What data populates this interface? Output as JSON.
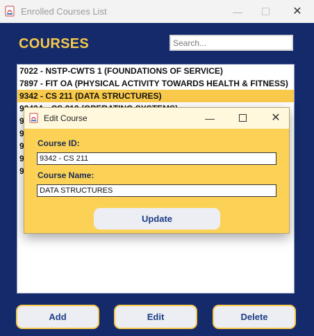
{
  "window": {
    "title": "Enrolled Courses List",
    "min": "—",
    "close": "✕"
  },
  "heading": "COURSES",
  "search": {
    "placeholder": "Search..."
  },
  "courses": [
    "7022 - NSTP-CWTS 1 (FOUNDATIONS OF SERVICE)",
    "7897 - FIT OA (PHYSICAL ACTIVITY TOWARDS HEALTH & FITNESS)",
    "9342 - CS 211 (DATA STRUCTURES)",
    "9343A - CS 212 (OPERATING SYSTEMS)",
    "9",
    "9",
    "9",
    "9",
    "9"
  ],
  "selected_course": "9342 - CS 211 (DATA STRUCTURES)",
  "buttons": {
    "add": "Add",
    "edit": "Edit",
    "delete": "Delete"
  },
  "dialog": {
    "title": "Edit Course",
    "min": "—",
    "close": "✕",
    "id_label": "Course ID:",
    "id_value": "9342 - CS 211",
    "name_label": "Course Name:",
    "name_value": "DATA STRUCTURES",
    "update_label": "Update"
  },
  "colors": {
    "accent": "#f8c94a",
    "background": "#142a6b",
    "button_text": "#1c3d87"
  }
}
